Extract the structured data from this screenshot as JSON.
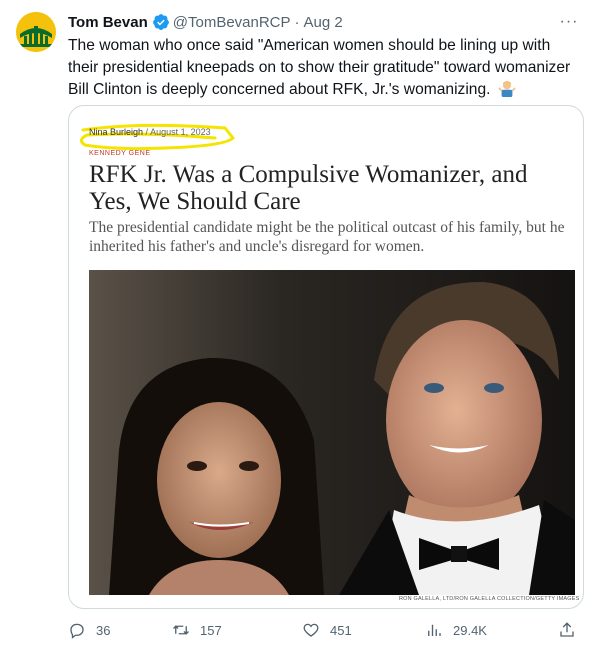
{
  "tweet": {
    "author_name": "Tom Bevan",
    "handle": "@TomBevanRCP",
    "separator": "·",
    "date": "Aug 2",
    "more_label": "···",
    "text": "The woman who once said \"American women should be lining up with their presidential kneepads on to show their gratitude\" toward womanizer Bill Clinton is deeply concerned about RFK, Jr.'s womanizing.",
    "emoji": "man-shrugging-emoji"
  },
  "card": {
    "author": "Nina Burleigh",
    "byline_sep": "/",
    "article_date": "August 1, 2023",
    "section": "KENNEDY GENE",
    "headline": "RFK Jr. Was a Compulsive Womanizer, and Yes, We Should Care",
    "dek": "The presidential candidate might be the political outcast of his family, but he inherited his father's and uncle's disregard for women.",
    "photo_credit": "RON GALELLA, LTD/RON GALELLA COLLECTION/GETTY IMAGES"
  },
  "actions": {
    "replies": "36",
    "retweets": "157",
    "likes": "451",
    "views": "29.4K"
  },
  "colors": {
    "text": "#0f1419",
    "muted": "#536471",
    "verified": "#1d9bf0",
    "highlight": "#f5e400",
    "border": "#cfd9de"
  }
}
